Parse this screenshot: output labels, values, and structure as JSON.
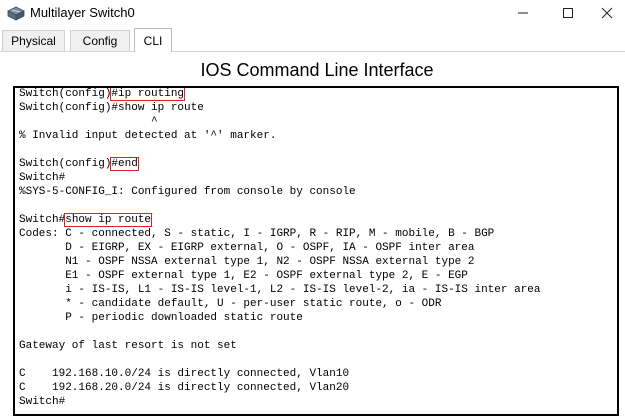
{
  "window": {
    "title": "Multilayer Switch0",
    "icon": "switch-icon"
  },
  "tabs": [
    {
      "label": "Physical",
      "active": false
    },
    {
      "label": "Config",
      "active": false
    },
    {
      "label": "CLI",
      "active": true
    }
  ],
  "cli": {
    "title": "IOS Command Line Interface"
  },
  "terminal": {
    "highlight_color": "#e02020",
    "lines": [
      {
        "pre": "Switch(config)",
        "hl": "#ip routing",
        "post": ""
      },
      {
        "pre": "Switch(config)#show ip route",
        "hl": "",
        "post": ""
      },
      {
        "pre": "                    ^",
        "hl": "",
        "post": ""
      },
      {
        "pre": "% Invalid input detected at '^' marker.",
        "hl": "",
        "post": ""
      },
      {
        "pre": "",
        "hl": "",
        "post": ""
      },
      {
        "pre": "Switch(config)",
        "hl": "#end",
        "post": ""
      },
      {
        "pre": "Switch#",
        "hl": "",
        "post": ""
      },
      {
        "pre": "%SYS-5-CONFIG_I: Configured from console by console",
        "hl": "",
        "post": ""
      },
      {
        "pre": "",
        "hl": "",
        "post": ""
      },
      {
        "pre": "Switch#",
        "hl": "show ip route",
        "post": ""
      },
      {
        "pre": "Codes: C - connected, S - static, I - IGRP, R - RIP, M - mobile, B - BGP",
        "hl": "",
        "post": ""
      },
      {
        "pre": "       D - EIGRP, EX - EIGRP external, O - OSPF, IA - OSPF inter area",
        "hl": "",
        "post": ""
      },
      {
        "pre": "       N1 - OSPF NSSA external type 1, N2 - OSPF NSSA external type 2",
        "hl": "",
        "post": ""
      },
      {
        "pre": "       E1 - OSPF external type 1, E2 - OSPF external type 2, E - EGP",
        "hl": "",
        "post": ""
      },
      {
        "pre": "       i - IS-IS, L1 - IS-IS level-1, L2 - IS-IS level-2, ia - IS-IS inter area",
        "hl": "",
        "post": ""
      },
      {
        "pre": "       * - candidate default, U - per-user static route, o - ODR",
        "hl": "",
        "post": ""
      },
      {
        "pre": "       P - periodic downloaded static route",
        "hl": "",
        "post": ""
      },
      {
        "pre": "",
        "hl": "",
        "post": ""
      },
      {
        "pre": "Gateway of last resort is not set",
        "hl": "",
        "post": ""
      },
      {
        "pre": "",
        "hl": "",
        "post": ""
      },
      {
        "pre": "C    192.168.10.0/24 is directly connected, Vlan10",
        "hl": "",
        "post": ""
      },
      {
        "pre": "C    192.168.20.0/24 is directly connected, Vlan20",
        "hl": "",
        "post": ""
      },
      {
        "pre": "Switch#",
        "hl": "",
        "post": ""
      }
    ]
  }
}
